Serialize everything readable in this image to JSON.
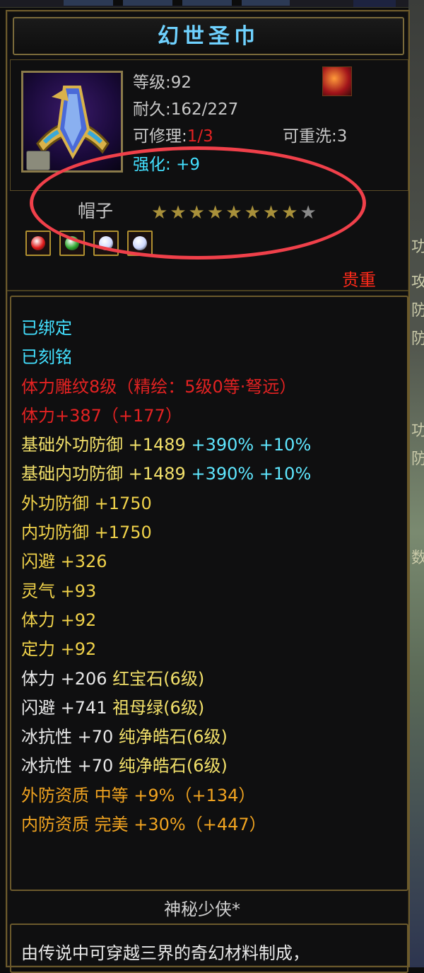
{
  "item": {
    "name": "幻世圣巾",
    "level_label": "等级:92",
    "durability_label": "耐久:162/227",
    "repair_prefix": "可修理:",
    "repair_value": "1/3",
    "rewash_label": "可重洗:3",
    "enhance_label": "强化:",
    "enhance_value": "+9",
    "slot": "帽子",
    "stars_total": 9,
    "stars_filled": 8,
    "rarity": "贵重"
  },
  "colors": {
    "title": "#6fd2ff",
    "gray": "#c8c8c8",
    "red": "#e32222",
    "cyan": "#43e0ff",
    "yellow": "#f2e06a",
    "orange": "#f0a320",
    "highlight_oval": "#f0404a"
  },
  "icons": [
    "helmet-item-icon",
    "bound-lock-icon",
    "equip-slot-icon"
  ],
  "gems": [
    {
      "name": "red-gem-icon",
      "color": "#e01a1a"
    },
    {
      "name": "green-gem-icon",
      "color": "#2ea62e"
    },
    {
      "name": "white-gem-icon-1",
      "color": "#cfd8ff"
    },
    {
      "name": "white-gem-icon-2",
      "color": "#cfd8ff"
    }
  ],
  "stats": [
    {
      "text": "已绑定",
      "color": "cyan"
    },
    {
      "text": "已刻铭",
      "color": "cyan"
    },
    {
      "text": "体力雕纹8级（精绘：5级0等·弩远）",
      "color": "red"
    },
    {
      "text": "体力+387（+177）",
      "color": "red"
    },
    {
      "parts": [
        {
          "text": "基础外功防御 +1489 ",
          "color": "yellow"
        },
        {
          "text": "+390% +10%",
          "color": "cyan2"
        }
      ]
    },
    {
      "parts": [
        {
          "text": "基础内功防御 +1489 ",
          "color": "yellow"
        },
        {
          "text": "+390% +10%",
          "color": "cyan2"
        }
      ]
    },
    {
      "text": "外功防御 +1750",
      "color": "yellow2"
    },
    {
      "text": "内功防御 +1750",
      "color": "yellow2"
    },
    {
      "text": "闪避 +326",
      "color": "yellow2"
    },
    {
      "text": "灵气 +93",
      "color": "yellow2"
    },
    {
      "text": "体力 +92",
      "color": "yellow2"
    },
    {
      "text": "定力 +92",
      "color": "yellow2"
    },
    {
      "parts": [
        {
          "text": "体力 +206 ",
          "color": "white"
        },
        {
          "text": "红宝石(6级)",
          "color": "yellow"
        }
      ]
    },
    {
      "parts": [
        {
          "text": "闪避 +741 ",
          "color": "white"
        },
        {
          "text": "祖母绿(6级)",
          "color": "yellow"
        }
      ]
    },
    {
      "parts": [
        {
          "text": "冰抗性 +70 ",
          "color": "white"
        },
        {
          "text": "纯净皓石(6级)",
          "color": "yellow"
        }
      ]
    },
    {
      "parts": [
        {
          "text": "冰抗性 +70 ",
          "color": "white"
        },
        {
          "text": "纯净皓石(6级)",
          "color": "yellow"
        }
      ]
    },
    {
      "text": "外防资质  中等 +9%（+134）",
      "color": "orange"
    },
    {
      "text": "内防资质  完美 +30%（+447）",
      "color": "orange"
    }
  ],
  "owner": "神秘少侠*",
  "description": "由传说中可穿越三界的奇幻材料制成，",
  "side_edge_chars": [
    "功",
    "攻",
    "防",
    "防",
    "功",
    "防",
    "数"
  ]
}
